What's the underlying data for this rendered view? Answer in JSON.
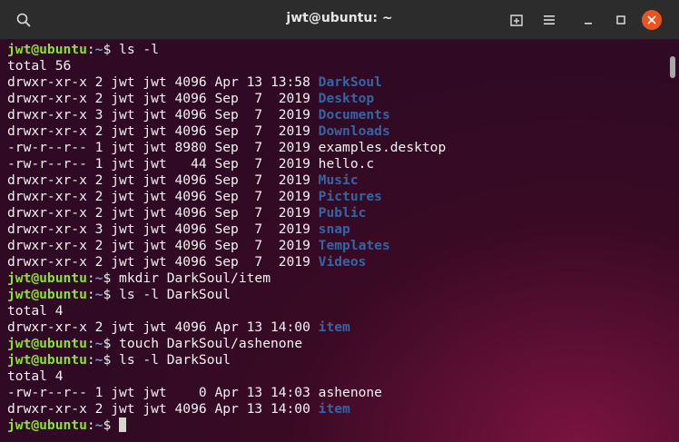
{
  "window": {
    "title": "jwt@ubuntu: ~"
  },
  "icons": {
    "search": "search-icon",
    "new_tab": "new-tab-icon",
    "menu": "hamburger-menu-icon",
    "minimize": "minimize-icon",
    "maximize": "maximize-icon",
    "close": "close-icon"
  },
  "colors": {
    "prompt_user": "#8ae234",
    "prompt_path": "#729fcf",
    "directory": "#3465a4",
    "text": "#f2f2f2",
    "close_button": "#e95420",
    "titlebar": "#2c2c2c",
    "background": "#300a24"
  },
  "terminal": {
    "prompt_user": "jwt@ubuntu",
    "prompt_colon": ":",
    "prompt_path": "~",
    "prompt_suffix": "$ ",
    "lines": [
      {
        "kind": "prompt",
        "cmd": "ls -l"
      },
      {
        "kind": "text",
        "text": "total 56"
      },
      {
        "kind": "entry",
        "meta": "drwxr-xr-x 2 jwt jwt 4096 Apr 13 13:58 ",
        "name": "DarkSoul",
        "type": "dir"
      },
      {
        "kind": "entry",
        "meta": "drwxr-xr-x 2 jwt jwt 4096 Sep  7  2019 ",
        "name": "Desktop",
        "type": "dir"
      },
      {
        "kind": "entry",
        "meta": "drwxr-xr-x 3 jwt jwt 4096 Sep  7  2019 ",
        "name": "Documents",
        "type": "dir"
      },
      {
        "kind": "entry",
        "meta": "drwxr-xr-x 2 jwt jwt 4096 Sep  7  2019 ",
        "name": "Downloads",
        "type": "dir"
      },
      {
        "kind": "entry",
        "meta": "-rw-r--r-- 1 jwt jwt 8980 Sep  7  2019 ",
        "name": "examples.desktop",
        "type": "file"
      },
      {
        "kind": "entry",
        "meta": "-rw-r--r-- 1 jwt jwt   44 Sep  7  2019 ",
        "name": "hello.c",
        "type": "file"
      },
      {
        "kind": "entry",
        "meta": "drwxr-xr-x 2 jwt jwt 4096 Sep  7  2019 ",
        "name": "Music",
        "type": "dir"
      },
      {
        "kind": "entry",
        "meta": "drwxr-xr-x 2 jwt jwt 4096 Sep  7  2019 ",
        "name": "Pictures",
        "type": "dir"
      },
      {
        "kind": "entry",
        "meta": "drwxr-xr-x 2 jwt jwt 4096 Sep  7  2019 ",
        "name": "Public",
        "type": "dir"
      },
      {
        "kind": "entry",
        "meta": "drwxr-xr-x 3 jwt jwt 4096 Sep  7  2019 ",
        "name": "snap",
        "type": "dir"
      },
      {
        "kind": "entry",
        "meta": "drwxr-xr-x 2 jwt jwt 4096 Sep  7  2019 ",
        "name": "Templates",
        "type": "dir"
      },
      {
        "kind": "entry",
        "meta": "drwxr-xr-x 2 jwt jwt 4096 Sep  7  2019 ",
        "name": "Videos",
        "type": "dir"
      },
      {
        "kind": "prompt",
        "cmd": "mkdir DarkSoul/item"
      },
      {
        "kind": "prompt",
        "cmd": "ls -l DarkSoul"
      },
      {
        "kind": "text",
        "text": "total 4"
      },
      {
        "kind": "entry",
        "meta": "drwxr-xr-x 2 jwt jwt 4096 Apr 13 14:00 ",
        "name": "item",
        "type": "dir"
      },
      {
        "kind": "prompt",
        "cmd": "touch DarkSoul/ashenone"
      },
      {
        "kind": "prompt",
        "cmd": "ls -l DarkSoul"
      },
      {
        "kind": "text",
        "text": "total 4"
      },
      {
        "kind": "entry",
        "meta": "-rw-r--r-- 1 jwt jwt    0 Apr 13 14:03 ",
        "name": "ashenone",
        "type": "file"
      },
      {
        "kind": "entry",
        "meta": "drwxr-xr-x 2 jwt jwt 4096 Apr 13 14:00 ",
        "name": "item",
        "type": "dir"
      },
      {
        "kind": "prompt",
        "cmd": "",
        "cursor": true
      }
    ]
  }
}
